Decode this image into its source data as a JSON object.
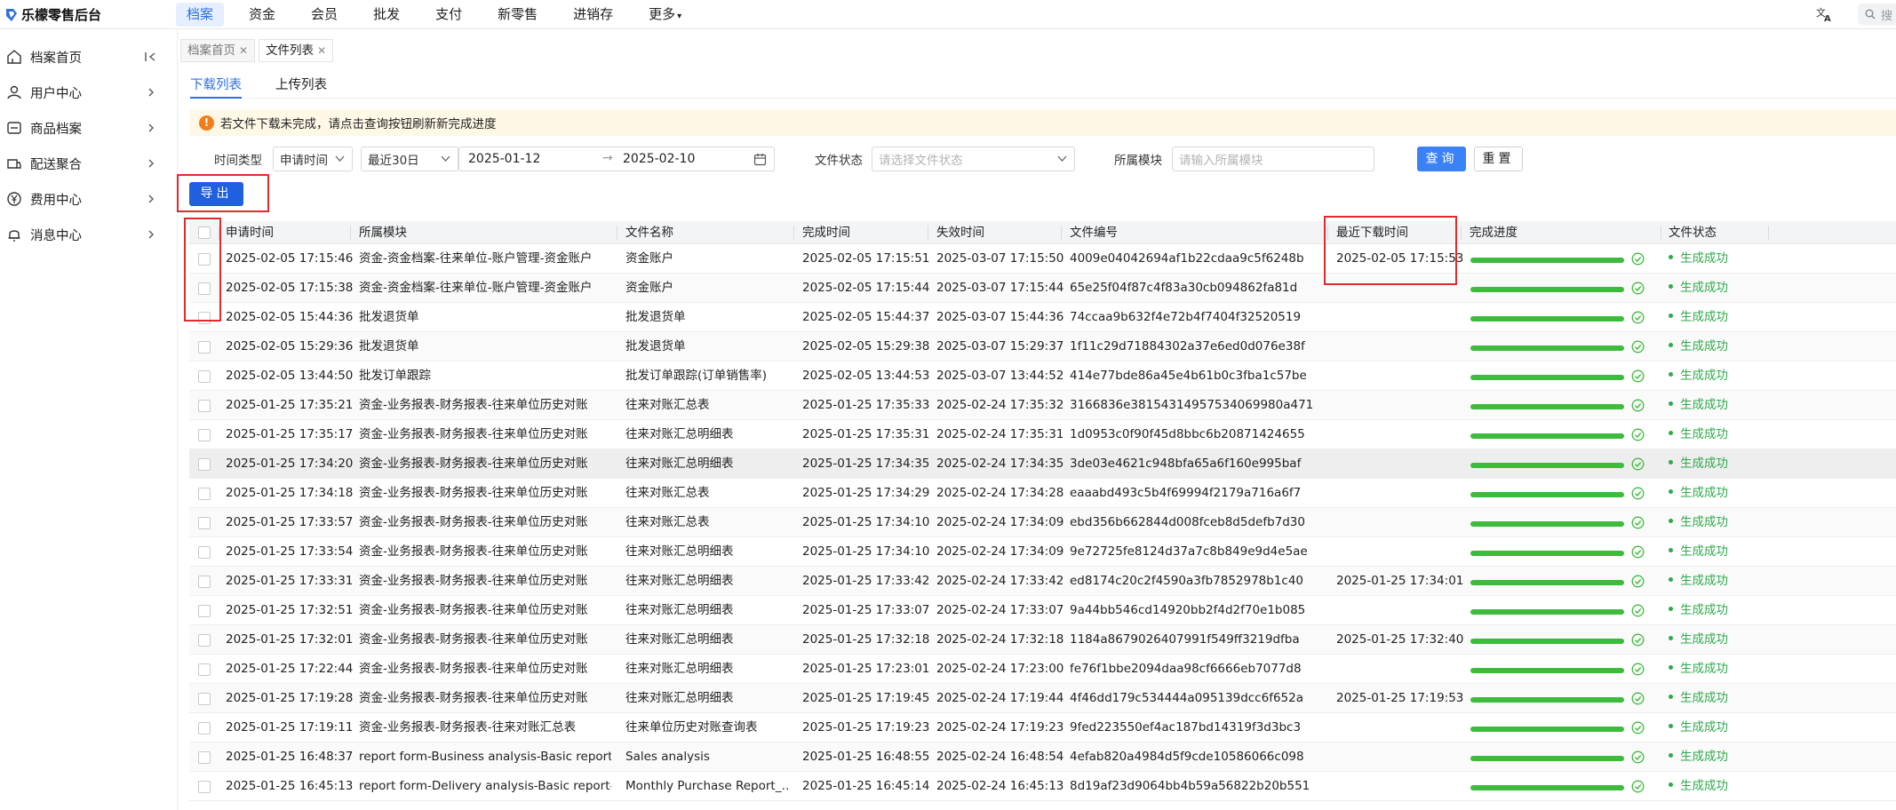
{
  "app": {
    "logo_text": "乐檬零售后台"
  },
  "topnav": [
    "档案",
    "资金",
    "会员",
    "批发",
    "支付",
    "新零售",
    "进销存",
    "更多"
  ],
  "top_search_placeholder": "搜",
  "sidebar": {
    "items": [
      {
        "label": "档案首页",
        "icon": "home-icon"
      },
      {
        "label": "用户中心",
        "icon": "user-icon"
      },
      {
        "label": "商品档案",
        "icon": "goods-icon"
      },
      {
        "label": "配送聚合",
        "icon": "delivery-icon"
      },
      {
        "label": "费用中心",
        "icon": "yen-icon"
      },
      {
        "label": "消息中心",
        "icon": "bell-icon"
      }
    ]
  },
  "page_tabs": [
    {
      "label": "档案首页",
      "active": false
    },
    {
      "label": "文件列表",
      "active": true
    }
  ],
  "sub_tabs": [
    "下载列表",
    "上传列表"
  ],
  "notice": "若文件下载未完成，请点击查询按钮刷新新完成进度",
  "filters": {
    "time_type_label": "时间类型",
    "time_type_value": "申请时间",
    "range_preset": "最近30日",
    "date_start": "2025-01-12",
    "date_sep": "→",
    "date_end": "2025-02-10",
    "file_status_label": "文件状态",
    "file_status_placeholder": "请选择文件状态",
    "module_label": "所属模块",
    "module_placeholder": "请输入所属模块",
    "query": "查询",
    "reset": "重置",
    "export": "导出"
  },
  "table": {
    "columns": [
      "申请时间",
      "所属模块",
      "文件名称",
      "完成时间",
      "失效时间",
      "文件编号",
      "最近下载时间",
      "完成进度",
      "文件状态"
    ],
    "progress_fraction": 1.0,
    "rows": [
      {
        "apply": "2025-02-05 17:15:46",
        "module": "资金-资金档案-往来单位-账户管理-资金账户",
        "name": "资金账户",
        "done": "2025-02-05 17:15:51",
        "expire": "2025-03-07 17:15:50",
        "id": "4009e04042694af1b22cdaa9c5f6248b",
        "last": "2025-02-05 17:15:53",
        "status": "生成成功"
      },
      {
        "apply": "2025-02-05 17:15:38",
        "module": "资金-资金档案-往来单位-账户管理-资金账户",
        "name": "资金账户",
        "done": "2025-02-05 17:15:44",
        "expire": "2025-03-07 17:15:44",
        "id": "65e25f04f87c4f83a30cb094862fa81d",
        "last": "",
        "status": "生成成功"
      },
      {
        "apply": "2025-02-05 15:44:36",
        "module": "批发退货单",
        "name": "批发退货单",
        "done": "2025-02-05 15:44:37",
        "expire": "2025-03-07 15:44:36",
        "id": "74ccaa9b632f4e72b4f7404f32520519",
        "last": "",
        "status": "生成成功"
      },
      {
        "apply": "2025-02-05 15:29:36",
        "module": "批发退货单",
        "name": "批发退货单",
        "done": "2025-02-05 15:29:38",
        "expire": "2025-03-07 15:29:37",
        "id": "1f11c29d71884302a37e6ed0d076e38f",
        "last": "",
        "status": "生成成功"
      },
      {
        "apply": "2025-02-05 13:44:50",
        "module": "批发订单跟踪",
        "name": "批发订单跟踪(订单销售率)",
        "done": "2025-02-05 13:44:53",
        "expire": "2025-03-07 13:44:52",
        "id": "414e77bde86a45e4b61b0c3fba1c57be",
        "last": "",
        "status": "生成成功"
      },
      {
        "apply": "2025-01-25 17:35:21",
        "module": "资金-业务报表-财务报表-往来单位历史对账",
        "name": "往来对账汇总表",
        "done": "2025-01-25 17:35:33",
        "expire": "2025-02-24 17:35:32",
        "id": "3166836e38154314957534069980a471",
        "last": "",
        "status": "生成成功"
      },
      {
        "apply": "2025-01-25 17:35:17",
        "module": "资金-业务报表-财务报表-往来单位历史对账",
        "name": "往来对账汇总明细表",
        "done": "2025-01-25 17:35:31",
        "expire": "2025-02-24 17:35:31",
        "id": "1d0953c0f90f45d8bbc6b20871424655",
        "last": "",
        "status": "生成成功"
      },
      {
        "apply": "2025-01-25 17:34:20",
        "module": "资金-业务报表-财务报表-往来单位历史对账",
        "name": "往来对账汇总明细表",
        "done": "2025-01-25 17:34:35",
        "expire": "2025-02-24 17:34:35",
        "id": "3de03e4621c948bfa65a6f160e995baf",
        "last": "",
        "status": "生成成功"
      },
      {
        "apply": "2025-01-25 17:34:18",
        "module": "资金-业务报表-财务报表-往来单位历史对账",
        "name": "往来对账汇总表",
        "done": "2025-01-25 17:34:29",
        "expire": "2025-02-24 17:34:28",
        "id": "eaaabd493c5b4f69994f2179a716a6f7",
        "last": "",
        "status": "生成成功"
      },
      {
        "apply": "2025-01-25 17:33:57",
        "module": "资金-业务报表-财务报表-往来单位历史对账",
        "name": "往来对账汇总表",
        "done": "2025-01-25 17:34:10",
        "expire": "2025-02-24 17:34:09",
        "id": "ebd356b662844d008fceb8d5defb7d30",
        "last": "",
        "status": "生成成功"
      },
      {
        "apply": "2025-01-25 17:33:54",
        "module": "资金-业务报表-财务报表-往来单位历史对账",
        "name": "往来对账汇总明细表",
        "done": "2025-01-25 17:34:10",
        "expire": "2025-02-24 17:34:09",
        "id": "9e72725fe8124d37a7c8b849e9d4e5ae",
        "last": "",
        "status": "生成成功"
      },
      {
        "apply": "2025-01-25 17:33:31",
        "module": "资金-业务报表-财务报表-往来单位历史对账",
        "name": "往来对账汇总明细表",
        "done": "2025-01-25 17:33:42",
        "expire": "2025-02-24 17:33:42",
        "id": "ed8174c20c2f4590a3fb7852978b1c40",
        "last": "2025-01-25 17:34:01",
        "status": "生成成功"
      },
      {
        "apply": "2025-01-25 17:32:51",
        "module": "资金-业务报表-财务报表-往来单位历史对账",
        "name": "往来对账汇总明细表",
        "done": "2025-01-25 17:33:07",
        "expire": "2025-02-24 17:33:07",
        "id": "9a44bb546cd14920bb2f4d2f70e1b085",
        "last": "",
        "status": "生成成功"
      },
      {
        "apply": "2025-01-25 17:32:01",
        "module": "资金-业务报表-财务报表-往来单位历史对账",
        "name": "往来对账汇总明细表",
        "done": "2025-01-25 17:32:18",
        "expire": "2025-02-24 17:32:18",
        "id": "1184a8679026407991f549ff3219dfba",
        "last": "2025-01-25 17:32:40",
        "status": "生成成功"
      },
      {
        "apply": "2025-01-25 17:22:44",
        "module": "资金-业务报表-财务报表-往来单位历史对账",
        "name": "往来对账汇总明细表",
        "done": "2025-01-25 17:23:01",
        "expire": "2025-02-24 17:23:00",
        "id": "fe76f1bbe2094daa98cf6666eb7077d8",
        "last": "",
        "status": "生成成功"
      },
      {
        "apply": "2025-01-25 17:19:28",
        "module": "资金-业务报表-财务报表-往来单位历史对账",
        "name": "往来对账汇总明细表",
        "done": "2025-01-25 17:19:45",
        "expire": "2025-02-24 17:19:44",
        "id": "4f46dd179c534444a095139dcc6f652a",
        "last": "2025-01-25 17:19:53",
        "status": "生成成功"
      },
      {
        "apply": "2025-01-25 17:19:11",
        "module": "资金-业务报表-财务报表-往来对账汇总表",
        "name": "往来单位历史对账查询表",
        "done": "2025-01-25 17:19:23",
        "expire": "2025-02-24 17:19:23",
        "id": "9fed223550ef4ac187bd14319f3d3bc3",
        "last": "",
        "status": "生成成功"
      },
      {
        "apply": "2025-01-25 16:48:37",
        "module": "report form-Business analysis-Basic report…",
        "name": "Sales analysis",
        "done": "2025-01-25 16:48:55",
        "expire": "2025-02-24 16:48:54",
        "id": "4efab820a4984d5f9cde10586066c098",
        "last": "",
        "status": "生成成功"
      },
      {
        "apply": "2025-01-25 16:45:13",
        "module": "report form-Delivery analysis-Basic report-…",
        "name": "Monthly Purchase Report_…",
        "done": "2025-01-25 16:45:14",
        "expire": "2025-02-24 16:45:13",
        "id": "8d19af23d9064bb4b59a56822b20b551",
        "last": "",
        "status": "生成成功"
      }
    ]
  },
  "colors": {
    "accent": "#2f6fe4",
    "export_btn": "#1f5fe0",
    "success": "#2faa4a",
    "progress": "#3dbb3d",
    "annotation": "#e32a2a"
  }
}
